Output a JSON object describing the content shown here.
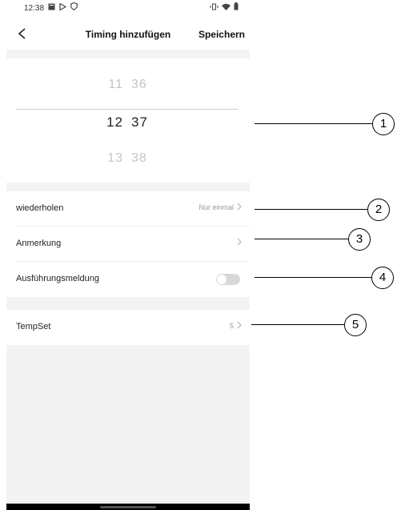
{
  "status_bar": {
    "time": "12:38"
  },
  "header": {
    "title": "Timing hinzufügen",
    "save_label": "Speichern"
  },
  "time_picker": {
    "rows": [
      {
        "hour": "11",
        "minute": "36"
      },
      {
        "hour": "12",
        "minute": "37"
      },
      {
        "hour": "13",
        "minute": "38"
      }
    ],
    "selected": {
      "hour": "12",
      "minute": "37"
    }
  },
  "settings": {
    "repeat_label": "wiederholen",
    "repeat_value": "Nur einmal",
    "note_label": "Anmerkung",
    "notification_label": "Ausführungsmeldung",
    "notification_enabled": false,
    "tempset_label": "TempSet",
    "tempset_value": "5"
  },
  "callouts": [
    "1",
    "2",
    "3",
    "4",
    "5"
  ]
}
